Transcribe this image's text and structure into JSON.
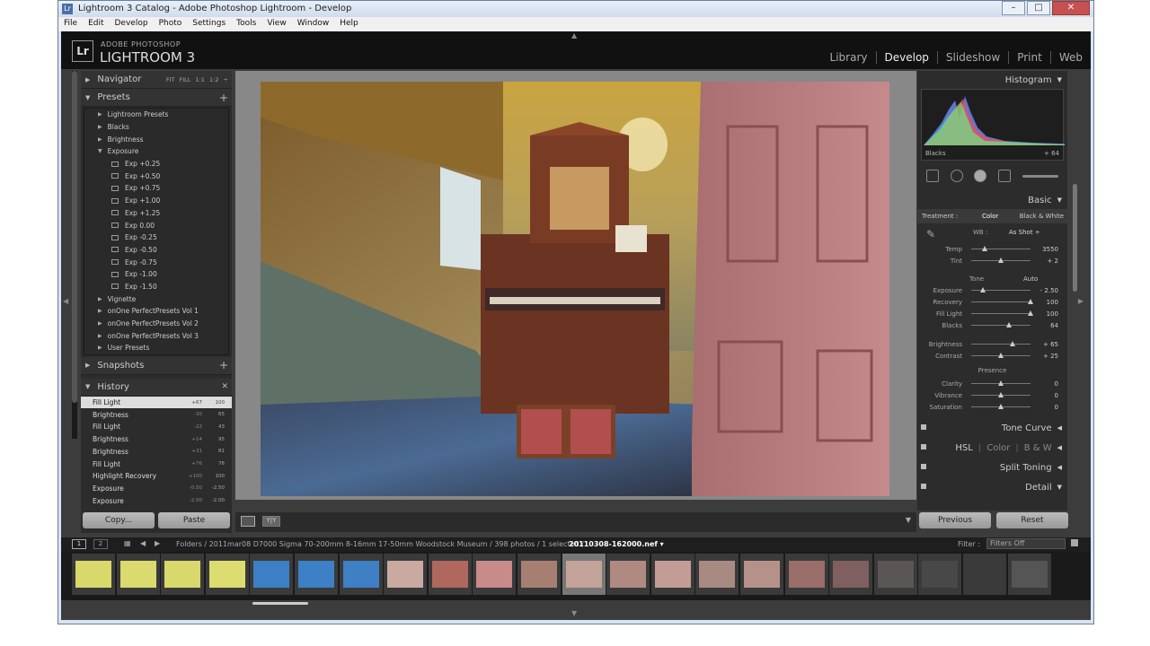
{
  "window": {
    "title": "Lightroom 3 Catalog - Adobe Photoshop Lightroom - Develop",
    "icon": "Lr",
    "min": "–",
    "max": "□",
    "close": "✕"
  },
  "menu": [
    "File",
    "Edit",
    "Develop",
    "Photo",
    "Settings",
    "Tools",
    "View",
    "Window",
    "Help"
  ],
  "brand": {
    "logo": "Lr",
    "line1": "ADOBE PHOTOSHOP",
    "line2": "LIGHTROOM 3"
  },
  "modules": [
    "Library",
    "Develop",
    "Slideshow",
    "Print",
    "Web"
  ],
  "navigator": {
    "title": "Navigator",
    "options": "FIT  FILL  1:1  1:2 ÷"
  },
  "presets": {
    "title": "Presets",
    "items": [
      {
        "label": "Lightroom Presets",
        "type": "folder"
      },
      {
        "label": "Blacks",
        "type": "folder"
      },
      {
        "label": "Brightness",
        "type": "folder"
      },
      {
        "label": "Exposure",
        "type": "open"
      },
      {
        "label": "Exp +0.25",
        "type": "preset"
      },
      {
        "label": "Exp +0.50",
        "type": "preset"
      },
      {
        "label": "Exp +0.75",
        "type": "preset"
      },
      {
        "label": "Exp +1.00",
        "type": "preset"
      },
      {
        "label": "Exp +1.25",
        "type": "preset"
      },
      {
        "label": "Exp 0.00",
        "type": "preset"
      },
      {
        "label": "Exp -0.25",
        "type": "preset"
      },
      {
        "label": "Exp -0.50",
        "type": "preset"
      },
      {
        "label": "Exp -0.75",
        "type": "preset"
      },
      {
        "label": "Exp -1.00",
        "type": "preset"
      },
      {
        "label": "Exp -1.50",
        "type": "preset"
      },
      {
        "label": "Vignette",
        "type": "folder"
      },
      {
        "label": "onOne PerfectPresets Vol 1",
        "type": "folder"
      },
      {
        "label": "onOne PerfectPresets Vol 2",
        "type": "folder"
      },
      {
        "label": "onOne PerfectPresets Vol 3",
        "type": "folder"
      },
      {
        "label": "User Presets",
        "type": "folder"
      }
    ]
  },
  "snapshots": {
    "title": "Snapshots"
  },
  "history": {
    "title": "History",
    "items": [
      {
        "label": "Fill Light",
        "a": "+67",
        "b": "100"
      },
      {
        "label": "Brightness",
        "a": "-30",
        "b": "65"
      },
      {
        "label": "Fill Light",
        "a": "-22",
        "b": "43"
      },
      {
        "label": "Brightness",
        "a": "+14",
        "b": "95"
      },
      {
        "label": "Brightness",
        "a": "+31",
        "b": "81"
      },
      {
        "label": "Fill Light",
        "a": "+76",
        "b": "76"
      },
      {
        "label": "Highlight Recovery",
        "a": "+100",
        "b": "100"
      },
      {
        "label": "Exposure",
        "a": "-0.50",
        "b": "-2.50"
      },
      {
        "label": "Exposure",
        "a": "-2.00",
        "b": "-2.00"
      }
    ]
  },
  "left_buttons": {
    "copy": "Copy...",
    "paste": "Paste"
  },
  "histogram": {
    "title": "Histogram",
    "label": "Blacks",
    "value": "+ 64"
  },
  "basic": {
    "title": "Basic",
    "treatment_label": "Treatment :",
    "color": "Color",
    "bw": "Black & White",
    "wb_label": "WB :",
    "wb_value": "As Shot ÷",
    "tone_label": "Tone",
    "auto": "Auto",
    "presence_label": "Presence",
    "wb_sliders": [
      {
        "name": "Temp",
        "value": "3550",
        "pos": 0.22
      },
      {
        "name": "Tint",
        "value": "+ 2",
        "pos": 0.5
      }
    ],
    "tone_sliders": [
      {
        "name": "Exposure",
        "value": "- 2.50",
        "pos": 0.2
      },
      {
        "name": "Recovery",
        "value": "100",
        "pos": 1.0
      },
      {
        "name": "Fill Light",
        "value": "100",
        "pos": 1.0
      },
      {
        "name": "Blacks",
        "value": "64",
        "pos": 0.64
      }
    ],
    "tone2_sliders": [
      {
        "name": "Brightness",
        "value": "+ 65",
        "pos": 0.7
      },
      {
        "name": "Contrast",
        "value": "+ 25",
        "pos": 0.5
      }
    ],
    "presence_sliders": [
      {
        "name": "Clarity",
        "value": "0",
        "pos": 0.5
      },
      {
        "name": "Vibrance",
        "value": "0",
        "pos": 0.5
      },
      {
        "name": "Saturation",
        "value": "0",
        "pos": 0.5
      }
    ]
  },
  "panels": {
    "tone_curve": "Tone Curve",
    "hsl": "HSL",
    "color": "Color",
    "bw": "B & W",
    "split_toning": "Split Toning",
    "detail": "Detail"
  },
  "right_buttons": {
    "previous": "Previous",
    "reset": "Reset"
  },
  "filmbar": {
    "page1": "1",
    "page2": "2",
    "path": "Folders / 2011mar08 D7000 Sigma 70-200mm 8-16mm 17-50mm Woodstock Museum / 398 photos / 1 selected /",
    "file": "20110308-162000.nef ▾",
    "filter_label": "Filter :",
    "filter_value": "Filters Off"
  },
  "thumbs": [
    "#d9d86a",
    "#dada6e",
    "#d8d86c",
    "#dcdc70",
    "#3d7fc4",
    "#3d80c6",
    "#3f7fc4",
    "#c9a9a0",
    "#b0675d",
    "#c98a8a",
    "#a77f72",
    "#c4a39a",
    "#b08a80",
    "#c39c95",
    "#a98a82",
    "#b6918a",
    "#9a6e6a",
    "#7f5f5f",
    "#5a5656",
    "#484848",
    "#3a3a3a",
    "#555"
  ]
}
